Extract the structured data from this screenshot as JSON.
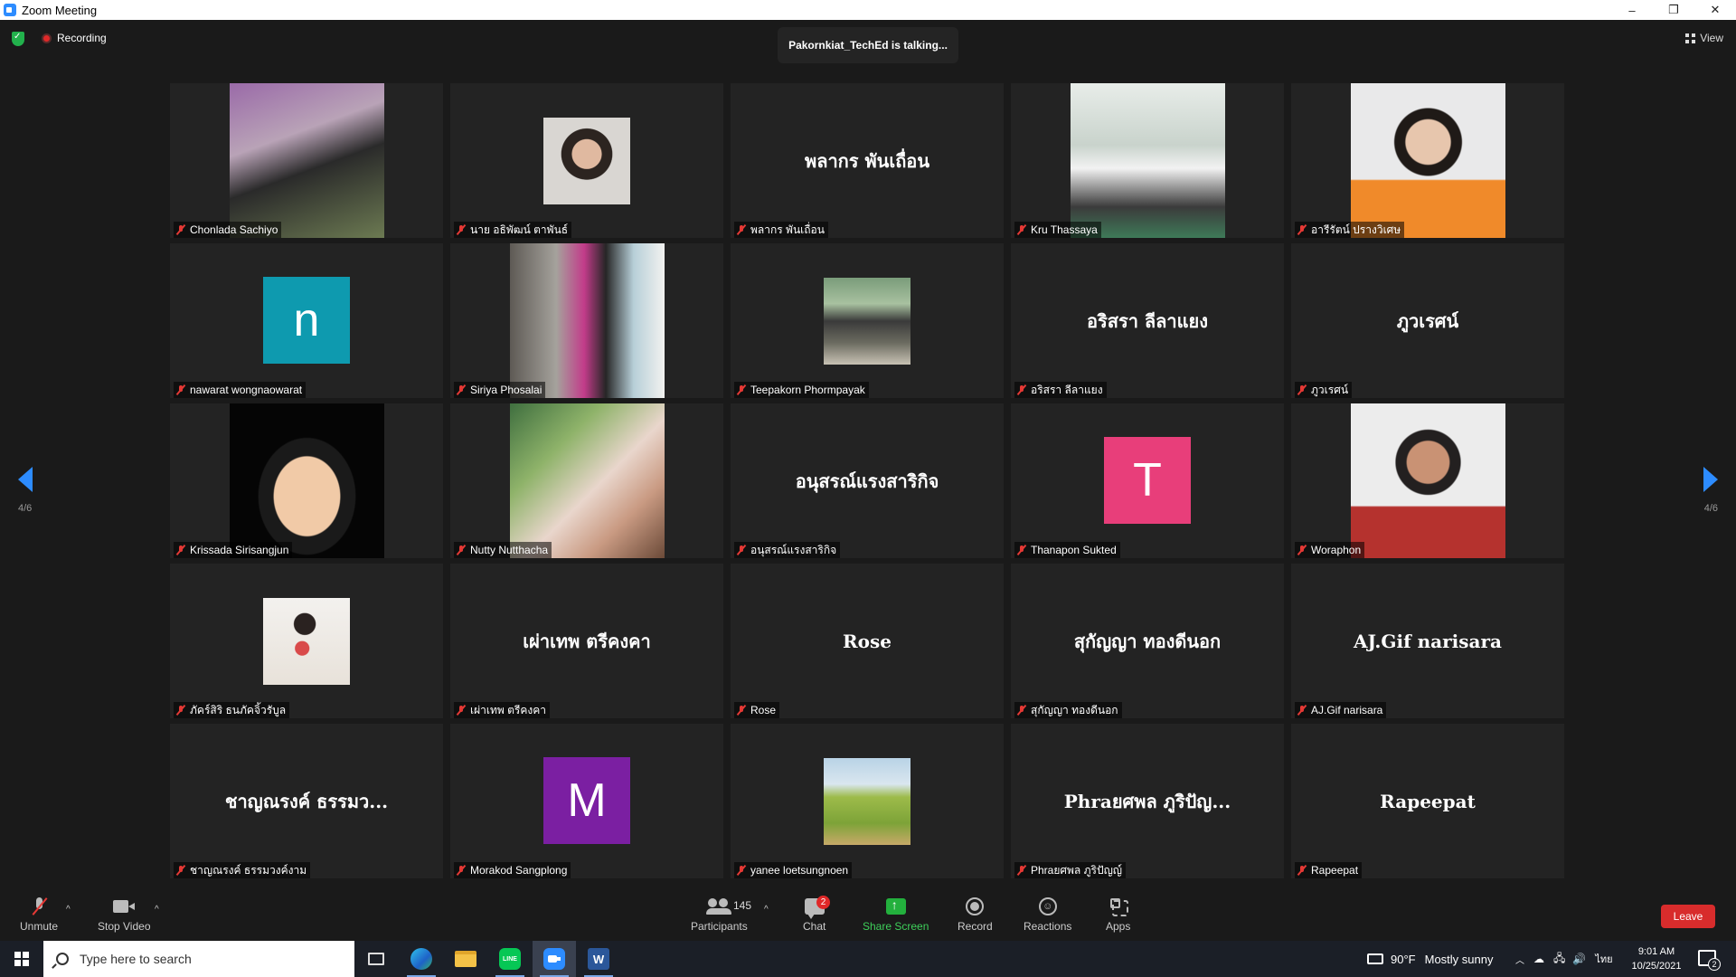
{
  "window": {
    "title": "Zoom Meeting",
    "minimize": "–",
    "restore": "❐",
    "close": "✕"
  },
  "topbar": {
    "recording_label": "Recording",
    "talking": "Pakornkiat_TechEd is talking...",
    "view_label": "View"
  },
  "pager": {
    "left": "4/6",
    "right": "4/6"
  },
  "tiles": [
    {
      "name": "Chonlada Sachiyo",
      "type": "video",
      "thumb": "woman-black-outfit-outdoor"
    },
    {
      "name": "นาย อธิพัฒน์ ตาพันธ์",
      "type": "video",
      "thumb": "young-man-headphones"
    },
    {
      "name": "พลากร พันเถื่อน",
      "type": "text",
      "display": "พลากร พันเถื่อน"
    },
    {
      "name": "Kru Thassaya",
      "type": "video",
      "thumb": "man-presenting-laptop"
    },
    {
      "name": "อารีรัตน์ ปรางวิเศษ",
      "type": "video",
      "thumb": "young-man-orange-shirt"
    },
    {
      "name": "nawarat wongnaowarat",
      "type": "letter",
      "display": "n",
      "color": "#0e9aaf"
    },
    {
      "name": "Siriya Phosalai",
      "type": "video",
      "thumb": "woman-pink-shirt-stairs"
    },
    {
      "name": "Teepakorn Phormpayak",
      "type": "video",
      "thumb": "train-photo"
    },
    {
      "name": "อริสรา ลีลาแยง",
      "type": "text",
      "display": "อริสรา ลีลาแยง"
    },
    {
      "name": "ภูวเรศน์",
      "type": "text",
      "display": "ภูวเรศน์"
    },
    {
      "name": "Krissada Sirisangjun",
      "type": "video",
      "thumb": "cartoon-avatar"
    },
    {
      "name": "Nutty Nutthacha",
      "type": "video",
      "thumb": "woman-tropical-cafe"
    },
    {
      "name": "อนุสรณ์แรงสาริกิจ",
      "type": "text",
      "display": "อนุสรณ์แรงสาริกิจ"
    },
    {
      "name": "Thanapon Sukted",
      "type": "letter",
      "display": "T",
      "color": "#e83e7a"
    },
    {
      "name": "Woraphon",
      "type": "video",
      "thumb": "young-man-red-shirt"
    },
    {
      "name": "ภัคร์สิริ ธนภัคจิ้วรับูล",
      "type": "video",
      "thumb": "woman-with-flowers"
    },
    {
      "name": "เผ่าเทพ  ตรีคงคา",
      "type": "text",
      "display": "เผ่าเทพ  ตรีคงคา"
    },
    {
      "name": "Rose",
      "type": "text",
      "display": "Rose"
    },
    {
      "name": "สุกัญญา ทองดีนอก",
      "type": "text",
      "display": "สุกัญญา ทองดีนอก"
    },
    {
      "name": "AJ.Gif narisara",
      "type": "text",
      "display": "AJ.Gif narisara"
    },
    {
      "name": "ชาญณรงค์ ธรรมวงค์งาม",
      "type": "text",
      "display": "ชาญณรงค์ ธรรมว..."
    },
    {
      "name": "Morakod Sangplong",
      "type": "letter",
      "display": "M",
      "color": "#7b1fa2"
    },
    {
      "name": "yanee loetsungnoen",
      "type": "video",
      "thumb": "woman-rice-field"
    },
    {
      "name": "Phraยศพล ภูริปัญญ์",
      "type": "text",
      "display": "Phraยศพล ภูริปัญ..."
    },
    {
      "name": "Rapeepat",
      "type": "text",
      "display": "Rapeepat"
    }
  ],
  "toolbar": {
    "unmute": "Unmute",
    "stop_video": "Stop Video",
    "participants": "Participants",
    "participants_count": "145",
    "chat": "Chat",
    "chat_badge": "2",
    "share_screen": "Share Screen",
    "record": "Record",
    "reactions": "Reactions",
    "apps": "Apps",
    "leave": "Leave",
    "caret": "^"
  },
  "taskbar": {
    "search_placeholder": "Type here to search",
    "line_label": "LINE",
    "word_label": "W",
    "temperature": "90°F",
    "weather": "Mostly sunny",
    "lang": "ไทย",
    "time": "9:01 AM",
    "date": "10/25/2021",
    "notif_count": "2"
  }
}
